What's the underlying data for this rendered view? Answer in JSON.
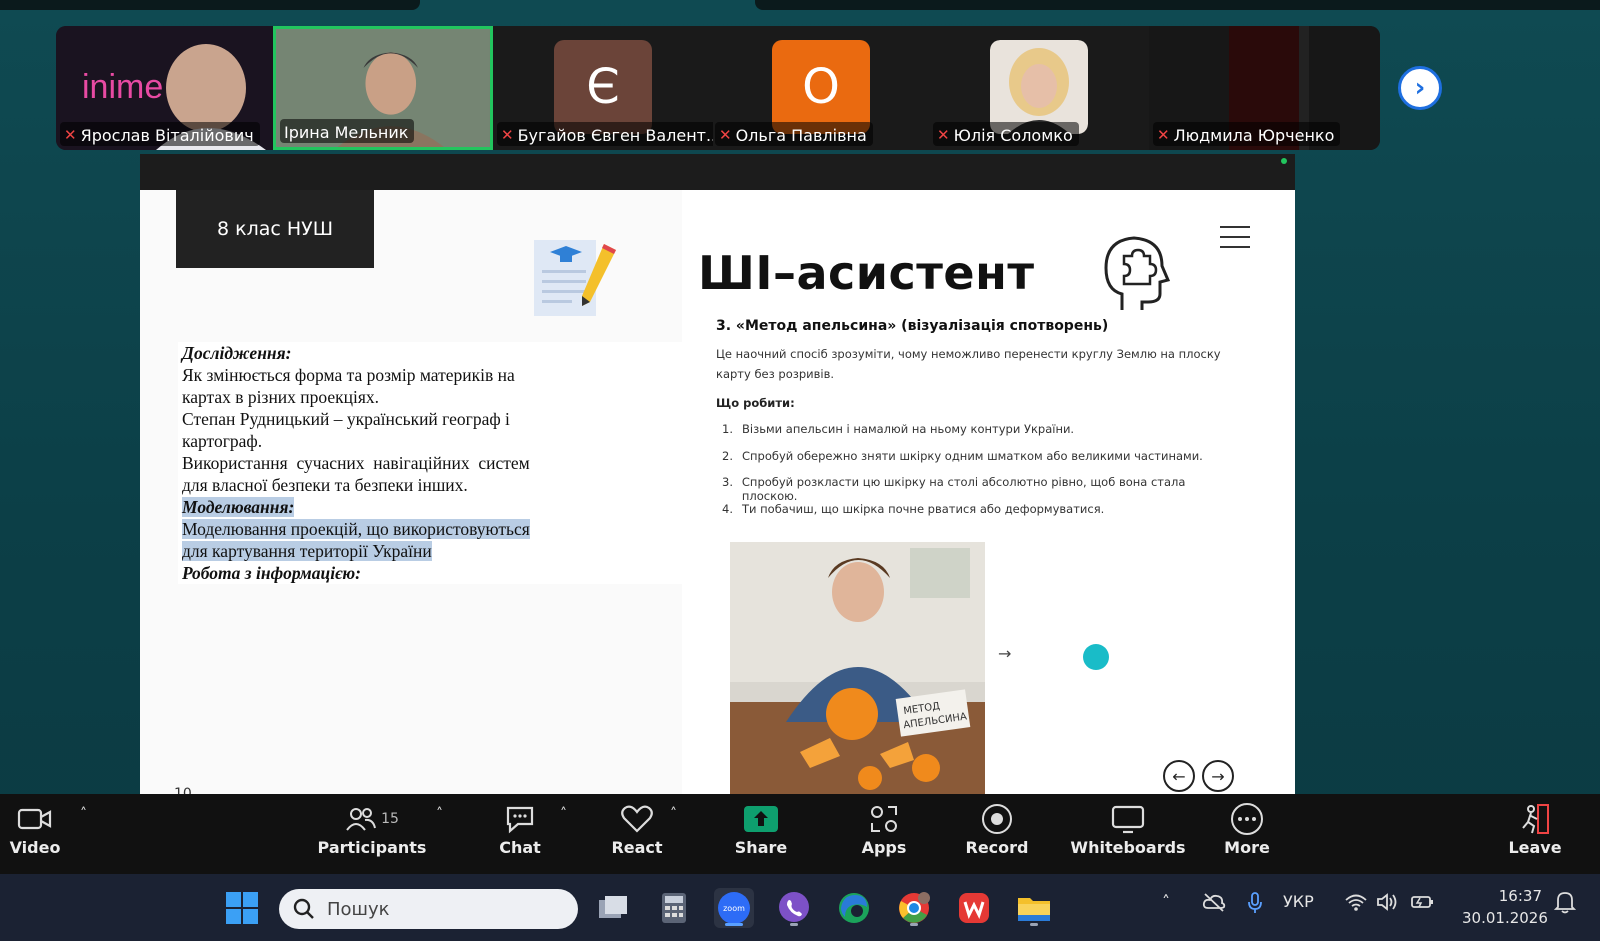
{
  "participants": [
    {
      "name": "Ярослав Віталійович",
      "muted": true,
      "logo_text": "inime"
    },
    {
      "name": "Ірина Мельник",
      "muted": false,
      "active": true
    },
    {
      "name": "Бугайов Євген Валент...",
      "muted": true,
      "avatar_letter": "Є",
      "avatar_color": "#6b4439"
    },
    {
      "name": "Ольга Павлівна",
      "muted": true,
      "avatar_letter": "О",
      "avatar_color": "#ea6a10"
    },
    {
      "name": "Юлія Соломко",
      "muted": true
    },
    {
      "name": "Людмила Юрченко",
      "muted": true
    }
  ],
  "slide": {
    "grade_label": "8 клас НУШ",
    "left_lines": [
      {
        "text": "Дослідження:",
        "style": "italic-bold"
      },
      {
        "text": "Як змінюється форма та розмір материків на",
        "style": "normal"
      },
      {
        "text": "картах в різних проекціях.",
        "style": "normal"
      },
      {
        "text": "Степан Рудницький – український географ і",
        "style": "normal"
      },
      {
        "text": "картограф.",
        "style": "normal"
      },
      {
        "text": "Використання  сучасних  навігаційних  систем",
        "style": "normal"
      },
      {
        "text": "для власної безпеки та безпеки інших.",
        "style": "normal"
      },
      {
        "text": "Моделювання:",
        "style": "italic-bold-highlight"
      },
      {
        "text": "Моделювання проекцій, що використовуються",
        "style": "highlight"
      },
      {
        "text": "для картування території України",
        "style": "highlight"
      },
      {
        "text": "Робота з інформацією:",
        "style": "italic-bold"
      }
    ],
    "page_number": "10",
    "title": "ШІ–асистент",
    "section_title": "3. «Метод апельсина» (візуалізація спотворень)",
    "section_desc": "Це наочний спосіб зрозуміти, чому неможливо перенести круглу Землю на плоску карту без розривів.",
    "what_to_do": "Що робити:",
    "steps": [
      "Візьми апельсин і намалюй на ньому контури України.",
      "Спробуй обережно зняти шкірку одним шматком або великими частинами.",
      "Спробуй розкласти цю шкірку на столі абсолютно рівно, щоб вона стала плоскою.",
      "Ти побачиш, що шкірка почне рватися або деформуватися."
    ],
    "photo_label_line1": "МЕТОД",
    "photo_label_line2": "АПЕЛЬСИНА",
    "accent_color": "#19bcc8"
  },
  "toolbar": {
    "video": "Video",
    "participants": "Participants",
    "participants_count": "15",
    "chat": "Chat",
    "react": "React",
    "share": "Share",
    "apps": "Apps",
    "record": "Record",
    "whiteboards": "Whiteboards",
    "more": "More",
    "leave": "Leave",
    "share_color": "#0e9f6e"
  },
  "taskbar": {
    "search_placeholder": "Пошук",
    "language": "УКР",
    "time": "16:37",
    "date": "30.01.2026",
    "zoom_label": "zoom"
  }
}
